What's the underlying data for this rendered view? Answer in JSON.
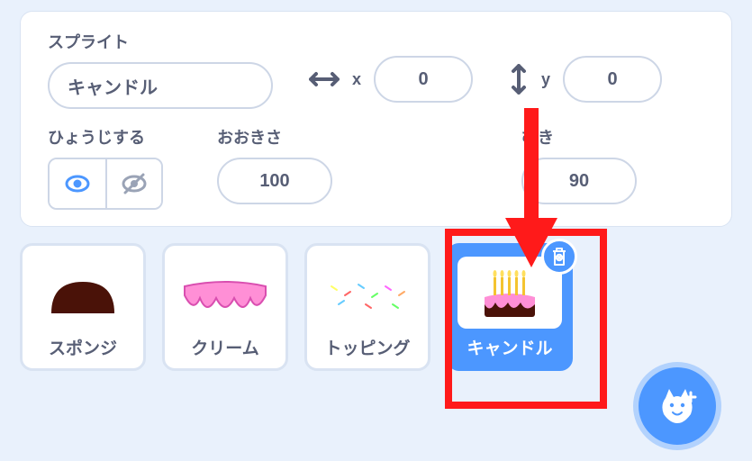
{
  "info": {
    "sprite_label": "スプライト",
    "sprite_name": "キャンドル",
    "x_label": "x",
    "x_value": "0",
    "y_label": "y",
    "y_value": "0",
    "show_label": "ひょうじする",
    "size_label": "おおきさ",
    "size_value": "100",
    "direction_label": "むき",
    "direction_value": "90"
  },
  "sprites": {
    "items": [
      {
        "name": "スポンジ"
      },
      {
        "name": "クリーム"
      },
      {
        "name": "トッピング"
      },
      {
        "name": "キャンドル"
      }
    ]
  }
}
